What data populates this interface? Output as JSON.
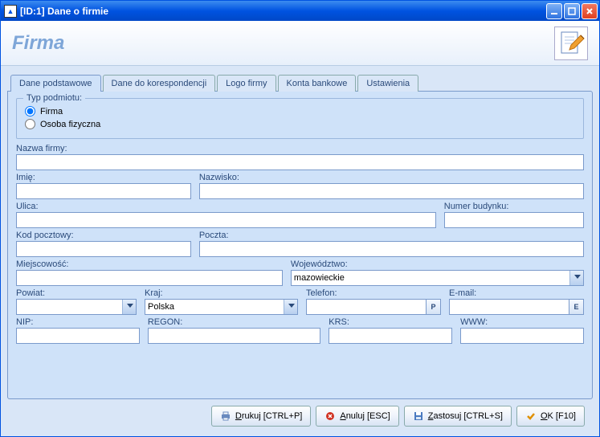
{
  "window": {
    "title": "[ID:1] Dane o firmie"
  },
  "header": {
    "title": "Firma"
  },
  "tabs": [
    {
      "label": "Dane podstawowe",
      "active": true
    },
    {
      "label": "Dane do korespondencji",
      "active": false
    },
    {
      "label": "Logo firmy",
      "active": false
    },
    {
      "label": "Konta bankowe",
      "active": false
    },
    {
      "label": "Ustawienia",
      "active": false
    }
  ],
  "entity_type": {
    "group_label": "Typ podmiotu:",
    "options": [
      {
        "label": "Firma",
        "selected": true
      },
      {
        "label": "Osoba fizyczna",
        "selected": false
      }
    ]
  },
  "fields": {
    "company_name": {
      "label": "Nazwa firmy:",
      "value": ""
    },
    "first_name": {
      "label": "Imię:",
      "value": ""
    },
    "last_name": {
      "label": "Nazwisko:",
      "value": ""
    },
    "street": {
      "label": "Ulica:",
      "value": ""
    },
    "building_no": {
      "label": "Numer budynku:",
      "value": ""
    },
    "postal_code": {
      "label": "Kod pocztowy:",
      "value": ""
    },
    "post_office": {
      "label": "Poczta:",
      "value": ""
    },
    "city": {
      "label": "Miejscowość:",
      "value": ""
    },
    "voivodeship": {
      "label": "Województwo:",
      "value": "mazowieckie"
    },
    "county": {
      "label": "Powiat:",
      "value": ""
    },
    "country": {
      "label": "Kraj:",
      "value": "Polska"
    },
    "phone": {
      "label": "Telefon:",
      "value": "",
      "btn": "P"
    },
    "email": {
      "label": "E-mail:",
      "value": "",
      "btn": "E"
    },
    "nip": {
      "label": "NIP:",
      "value": ""
    },
    "regon": {
      "label": "REGON:",
      "value": ""
    },
    "krs": {
      "label": "KRS:",
      "value": ""
    },
    "www": {
      "label": "WWW:",
      "value": ""
    }
  },
  "buttons": {
    "print": {
      "letter": "D",
      "rest": "rukuj [CTRL+P]"
    },
    "cancel": {
      "letter": "A",
      "rest": "nuluj [ESC]"
    },
    "apply": {
      "letter": "Z",
      "rest": "astosuj [CTRL+S]"
    },
    "ok": {
      "letter": "O",
      "rest": "K [F10]"
    }
  },
  "colors": {
    "accent": "#0053e1",
    "panel": "#cfe2f9"
  }
}
